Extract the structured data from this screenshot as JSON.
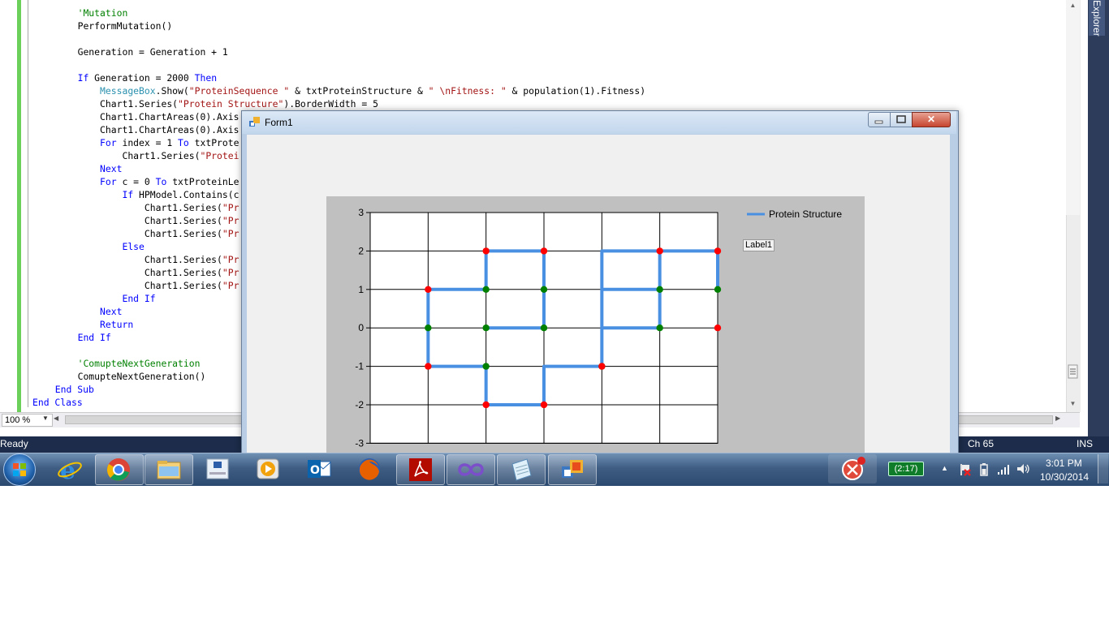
{
  "editor": {
    "lines": [
      [
        {
          "t": "'Mutation",
          "c": "comment"
        }
      ],
      [
        {
          "t": "PerformMutation()",
          "c": "plain"
        }
      ],
      [],
      [
        {
          "t": "Generation = Generation + 1",
          "c": "plain"
        }
      ],
      [],
      [
        {
          "t": "If ",
          "c": "keyword"
        },
        {
          "t": "Generation = 2000 ",
          "c": "plain"
        },
        {
          "t": "Then",
          "c": "keyword"
        }
      ],
      [
        {
          "t": "    ",
          "c": "plain"
        },
        {
          "t": "MessageBox",
          "c": "type"
        },
        {
          "t": ".Show(",
          "c": "plain"
        },
        {
          "t": "\"ProteinSequence \"",
          "c": "string"
        },
        {
          "t": " & txtProteinStructure & ",
          "c": "plain"
        },
        {
          "t": "\" \\nFitness: \"",
          "c": "string"
        },
        {
          "t": " & population(1).Fitness)",
          "c": "plain"
        }
      ],
      [
        {
          "t": "    Chart1.Series(",
          "c": "plain"
        },
        {
          "t": "\"Protein Structure\"",
          "c": "string"
        },
        {
          "t": ").BorderWidth = 5",
          "c": "plain"
        }
      ],
      [
        {
          "t": "    Chart1.ChartAreas(0).Axis",
          "c": "plain"
        }
      ],
      [
        {
          "t": "    Chart1.ChartAreas(0).Axis",
          "c": "plain"
        }
      ],
      [
        {
          "t": "    ",
          "c": "plain"
        },
        {
          "t": "For ",
          "c": "keyword"
        },
        {
          "t": "index = 1 ",
          "c": "plain"
        },
        {
          "t": "To ",
          "c": "keyword"
        },
        {
          "t": "txtProte",
          "c": "plain"
        }
      ],
      [
        {
          "t": "        Chart1.Series(",
          "c": "plain"
        },
        {
          "t": "\"Protei",
          "c": "string"
        }
      ],
      [
        {
          "t": "    ",
          "c": "plain"
        },
        {
          "t": "Next",
          "c": "keyword"
        }
      ],
      [
        {
          "t": "    ",
          "c": "plain"
        },
        {
          "t": "For ",
          "c": "keyword"
        },
        {
          "t": "c = 0 ",
          "c": "plain"
        },
        {
          "t": "To ",
          "c": "keyword"
        },
        {
          "t": "txtProteinLe",
          "c": "plain"
        }
      ],
      [
        {
          "t": "        ",
          "c": "plain"
        },
        {
          "t": "If ",
          "c": "keyword"
        },
        {
          "t": "HPModel.Contains(c",
          "c": "plain"
        }
      ],
      [
        {
          "t": "            Chart1.Series(",
          "c": "plain"
        },
        {
          "t": "\"Pr",
          "c": "string"
        }
      ],
      [
        {
          "t": "            Chart1.Series(",
          "c": "plain"
        },
        {
          "t": "\"Pr",
          "c": "string"
        }
      ],
      [
        {
          "t": "            Chart1.Series(",
          "c": "plain"
        },
        {
          "t": "\"Pr",
          "c": "string"
        }
      ],
      [
        {
          "t": "        ",
          "c": "plain"
        },
        {
          "t": "Else",
          "c": "keyword"
        }
      ],
      [
        {
          "t": "            Chart1.Series(",
          "c": "plain"
        },
        {
          "t": "\"Pr",
          "c": "string"
        }
      ],
      [
        {
          "t": "            Chart1.Series(",
          "c": "plain"
        },
        {
          "t": "\"Pr",
          "c": "string"
        }
      ],
      [
        {
          "t": "            Chart1.Series(",
          "c": "plain"
        },
        {
          "t": "\"Pr",
          "c": "string"
        }
      ],
      [
        {
          "t": "        ",
          "c": "plain"
        },
        {
          "t": "End If",
          "c": "keyword"
        }
      ],
      [
        {
          "t": "    ",
          "c": "plain"
        },
        {
          "t": "Next",
          "c": "keyword"
        }
      ],
      [
        {
          "t": "    ",
          "c": "plain"
        },
        {
          "t": "Return",
          "c": "keyword"
        }
      ],
      [
        {
          "t": "End If",
          "c": "keyword"
        }
      ],
      [],
      [
        {
          "t": "'ComupteNextGeneration",
          "c": "comment"
        }
      ],
      [
        {
          "t": "ComupteNextGeneration()",
          "c": "plain"
        }
      ],
      [
        {
          "t": "End Sub",
          "c": "keyword"
        }
      ],
      [
        {
          "t": "End Class",
          "c": "keyword"
        }
      ]
    ],
    "line_indents": [
      8,
      8,
      0,
      8,
      0,
      8,
      8,
      8,
      8,
      8,
      8,
      8,
      8,
      8,
      8,
      8,
      8,
      8,
      8,
      8,
      8,
      8,
      8,
      8,
      8,
      8,
      0,
      8,
      8,
      4,
      0
    ],
    "zoom": "100 %",
    "side_tab": "Explorer"
  },
  "statusbar": {
    "ready": "Ready",
    "column": "Ch 65",
    "mode": "INS"
  },
  "form": {
    "title": "Form1",
    "label1": "Label1"
  },
  "chart_data": {
    "type": "line",
    "series": [
      {
        "name": "Protein Structure",
        "color": "#4a90e2",
        "points": [
          [
            3,
            1
          ],
          [
            3,
            2
          ],
          [
            2,
            2
          ],
          [
            2,
            0
          ],
          [
            1,
            0
          ],
          [
            1,
            1
          ],
          [
            2,
            1
          ],
          [
            2,
            2
          ],
          [
            1,
            2
          ],
          [
            1,
            -1
          ],
          [
            0,
            -1
          ],
          [
            0,
            -2
          ],
          [
            -1,
            -2
          ],
          [
            -1,
            -1
          ],
          [
            -2,
            -1
          ],
          [
            -2,
            0
          ],
          [
            -2,
            1
          ],
          [
            -1,
            1
          ],
          [
            -1,
            2
          ],
          [
            0,
            2
          ],
          [
            0,
            1
          ],
          [
            0,
            0
          ],
          [
            -1,
            0
          ]
        ]
      }
    ],
    "point_colors": {
      "hydrophobic": "#ff0000",
      "polar": "#008000"
    },
    "red_points": [
      [
        -2,
        1
      ],
      [
        -2,
        -1
      ],
      [
        -1,
        2
      ],
      [
        0,
        2
      ],
      [
        2,
        2
      ],
      [
        3,
        2
      ],
      [
        3,
        0
      ],
      [
        1,
        -1
      ],
      [
        -1,
        -2
      ],
      [
        0,
        -2
      ]
    ],
    "green_points": [
      [
        -2,
        0
      ],
      [
        -1,
        1
      ],
      [
        0,
        1
      ],
      [
        2,
        1
      ],
      [
        3,
        1
      ],
      [
        -1,
        0
      ],
      [
        0,
        0
      ],
      [
        2,
        0
      ],
      [
        -1,
        -1
      ],
      [
        1,
        -1.0001
      ]
    ],
    "xlim": [
      -3,
      3
    ],
    "ylim": [
      -3,
      3
    ],
    "ytick_labels": [
      "3",
      "2",
      "1",
      "0",
      "-1",
      "-2",
      "-3"
    ],
    "grid": true,
    "legend": "top-right"
  },
  "taskbar": {
    "clock_time": "3:01 PM",
    "clock_date": "10/30/2014",
    "battery": "(2:17)",
    "apps": [
      "internet-explorer",
      "chrome",
      "file-explorer",
      "remote-app",
      "media-player",
      "outlook",
      "firefox",
      "acrobat",
      "visual-studio",
      "notepad",
      "windows-forms"
    ]
  }
}
